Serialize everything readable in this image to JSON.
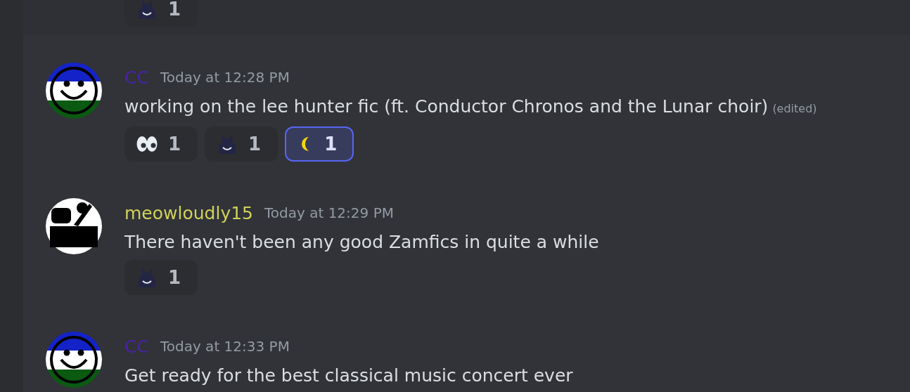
{
  "messages": [
    {
      "hovered": true,
      "reactions": [
        {
          "kind": "cat",
          "count": "1",
          "selected": false
        }
      ]
    },
    {
      "author": {
        "name": "CC",
        "color": "#4a22a8",
        "kind": "smiley"
      },
      "timestamp": "Today at 12:28 PM",
      "text": "working on the lee hunter fic (ft. Conductor Chronos and the Lunar choir)",
      "edited": "(edited)",
      "reactions": [
        {
          "kind": "eyes",
          "count": "1",
          "selected": false
        },
        {
          "kind": "cat",
          "count": "1",
          "selected": false
        },
        {
          "kind": "moon",
          "count": "1",
          "selected": true
        }
      ]
    },
    {
      "author": {
        "name": "meowloudly15",
        "color": "#d1d15a",
        "kind": "poster"
      },
      "timestamp": "Today at 12:29 PM",
      "text": "There haven't been any good Zamfics in quite a while",
      "reactions": [
        {
          "kind": "cat",
          "count": "1",
          "selected": false
        }
      ]
    },
    {
      "author": {
        "name": "CC",
        "color": "#4a22a8",
        "kind": "smiley"
      },
      "timestamp": "Today at 12:33 PM",
      "text": "Get ready for the best classical music concert ever"
    }
  ]
}
